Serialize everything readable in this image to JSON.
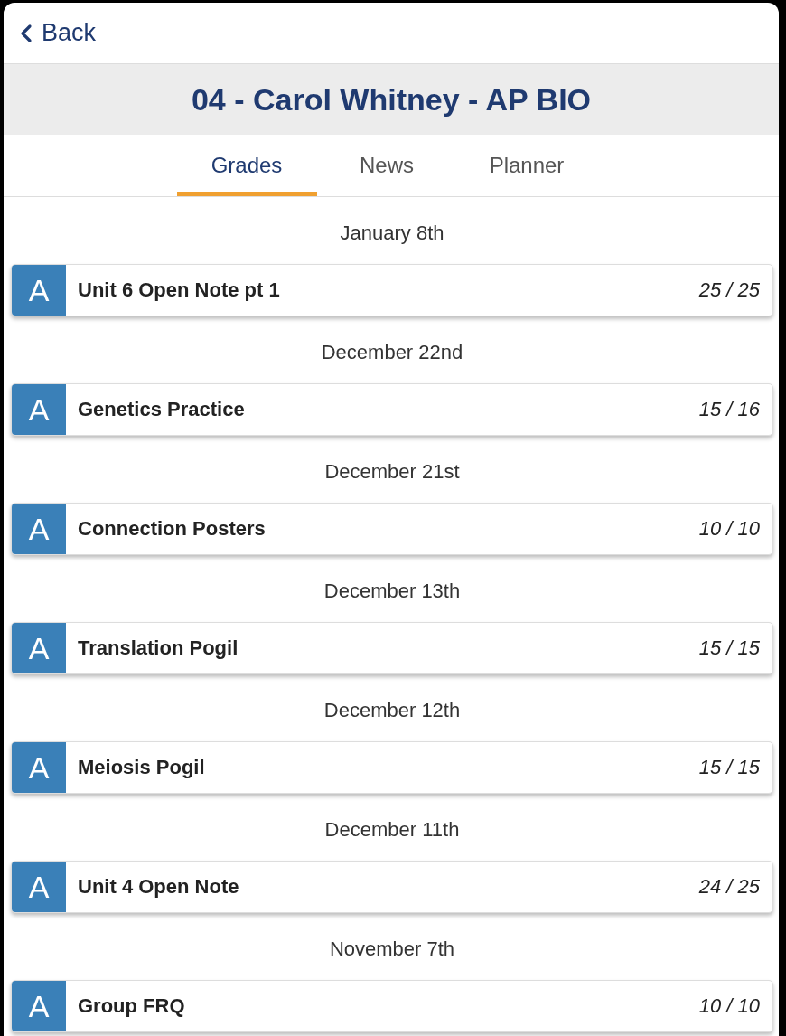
{
  "back": {
    "label": "Back"
  },
  "title": "04 - Carol Whitney - AP BIO",
  "tabs": [
    {
      "label": "Grades",
      "selected": true
    },
    {
      "label": "News",
      "selected": false
    },
    {
      "label": "Planner",
      "selected": false
    }
  ],
  "groups": [
    {
      "date": "January 8th",
      "items": [
        {
          "grade": "A",
          "name": "Unit 6 Open Note pt 1",
          "score": "25 / 25"
        }
      ]
    },
    {
      "date": "December 22nd",
      "items": [
        {
          "grade": "A",
          "name": "Genetics Practice",
          "score": "15 / 16"
        }
      ]
    },
    {
      "date": "December 21st",
      "items": [
        {
          "grade": "A",
          "name": "Connection Posters",
          "score": "10 / 10"
        }
      ]
    },
    {
      "date": "December 13th",
      "items": [
        {
          "grade": "A",
          "name": "Translation Pogil",
          "score": "15 / 15"
        }
      ]
    },
    {
      "date": "December 12th",
      "items": [
        {
          "grade": "A",
          "name": "Meiosis Pogil",
          "score": "15 / 15"
        }
      ]
    },
    {
      "date": "December 11th",
      "items": [
        {
          "grade": "A",
          "name": "Unit 4 Open Note",
          "score": "24 / 25"
        }
      ]
    },
    {
      "date": "November 7th",
      "items": [
        {
          "grade": "A",
          "name": "Group FRQ",
          "score": "10 / 10"
        }
      ]
    }
  ]
}
